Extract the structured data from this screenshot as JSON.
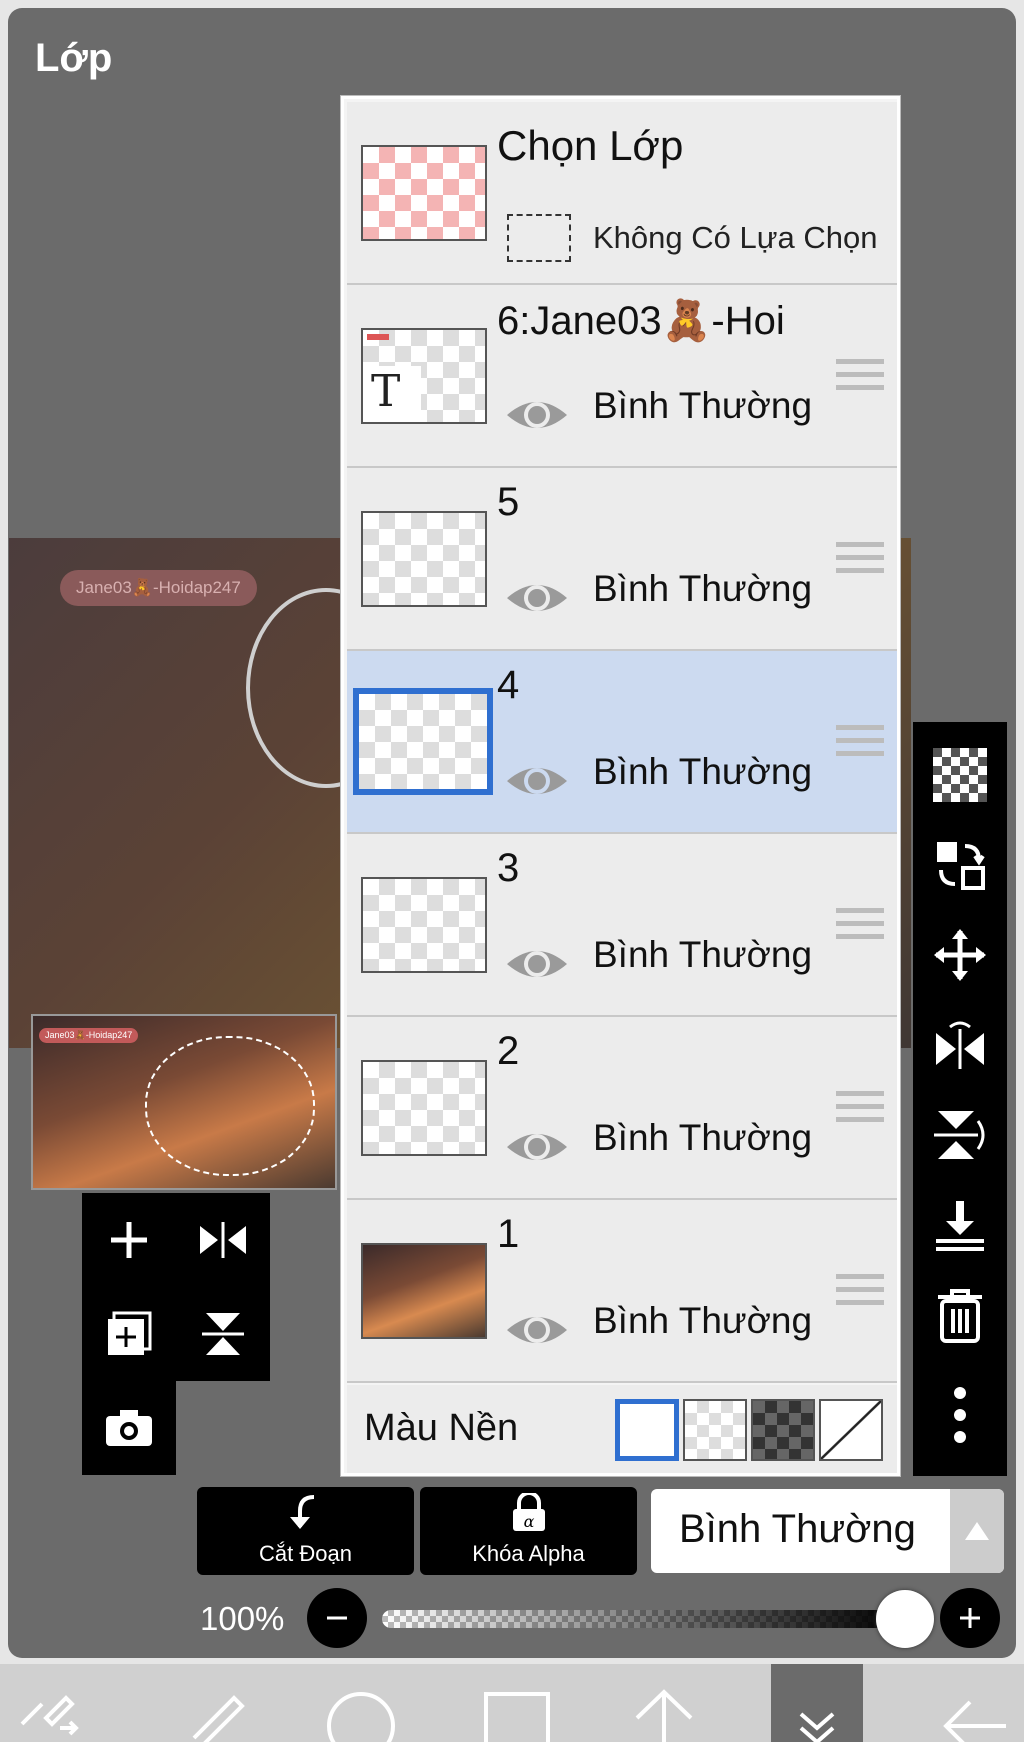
{
  "header": {
    "title": "Lớp"
  },
  "canvas": {
    "watermark": "Jane03🧸-Hoidap247"
  },
  "select_layer": {
    "title": "Chọn Lớp",
    "status": "Không Có Lựa Chọn"
  },
  "layers": [
    {
      "name": "6:Jane03🧸-Hoi",
      "blend": "Bình Thường",
      "type": "text",
      "selected": false
    },
    {
      "name": "5",
      "blend": "Bình Thường",
      "type": "raster",
      "selected": false
    },
    {
      "name": "4",
      "blend": "Bình Thường",
      "type": "raster",
      "selected": true
    },
    {
      "name": "3",
      "blend": "Bình Thường",
      "type": "raster",
      "selected": false
    },
    {
      "name": "2",
      "blend": "Bình Thường",
      "type": "raster",
      "selected": false
    },
    {
      "name": "1",
      "blend": "Bình Thường",
      "type": "image",
      "selected": false
    }
  ],
  "background": {
    "label": "Màu Nền",
    "options": [
      "white",
      "light-checker",
      "dark-checker",
      "none"
    ],
    "selected": "white"
  },
  "controls": {
    "clipping_label": "Cắt Đoạn",
    "alpha_lock_label": "Khóa Alpha",
    "blend_mode": "Bình Thường",
    "opacity": "100%"
  },
  "colors": {
    "accent": "#2f6fd0",
    "selected_row": "#ccdaf0",
    "panel_bg": "#6b6b6b"
  }
}
